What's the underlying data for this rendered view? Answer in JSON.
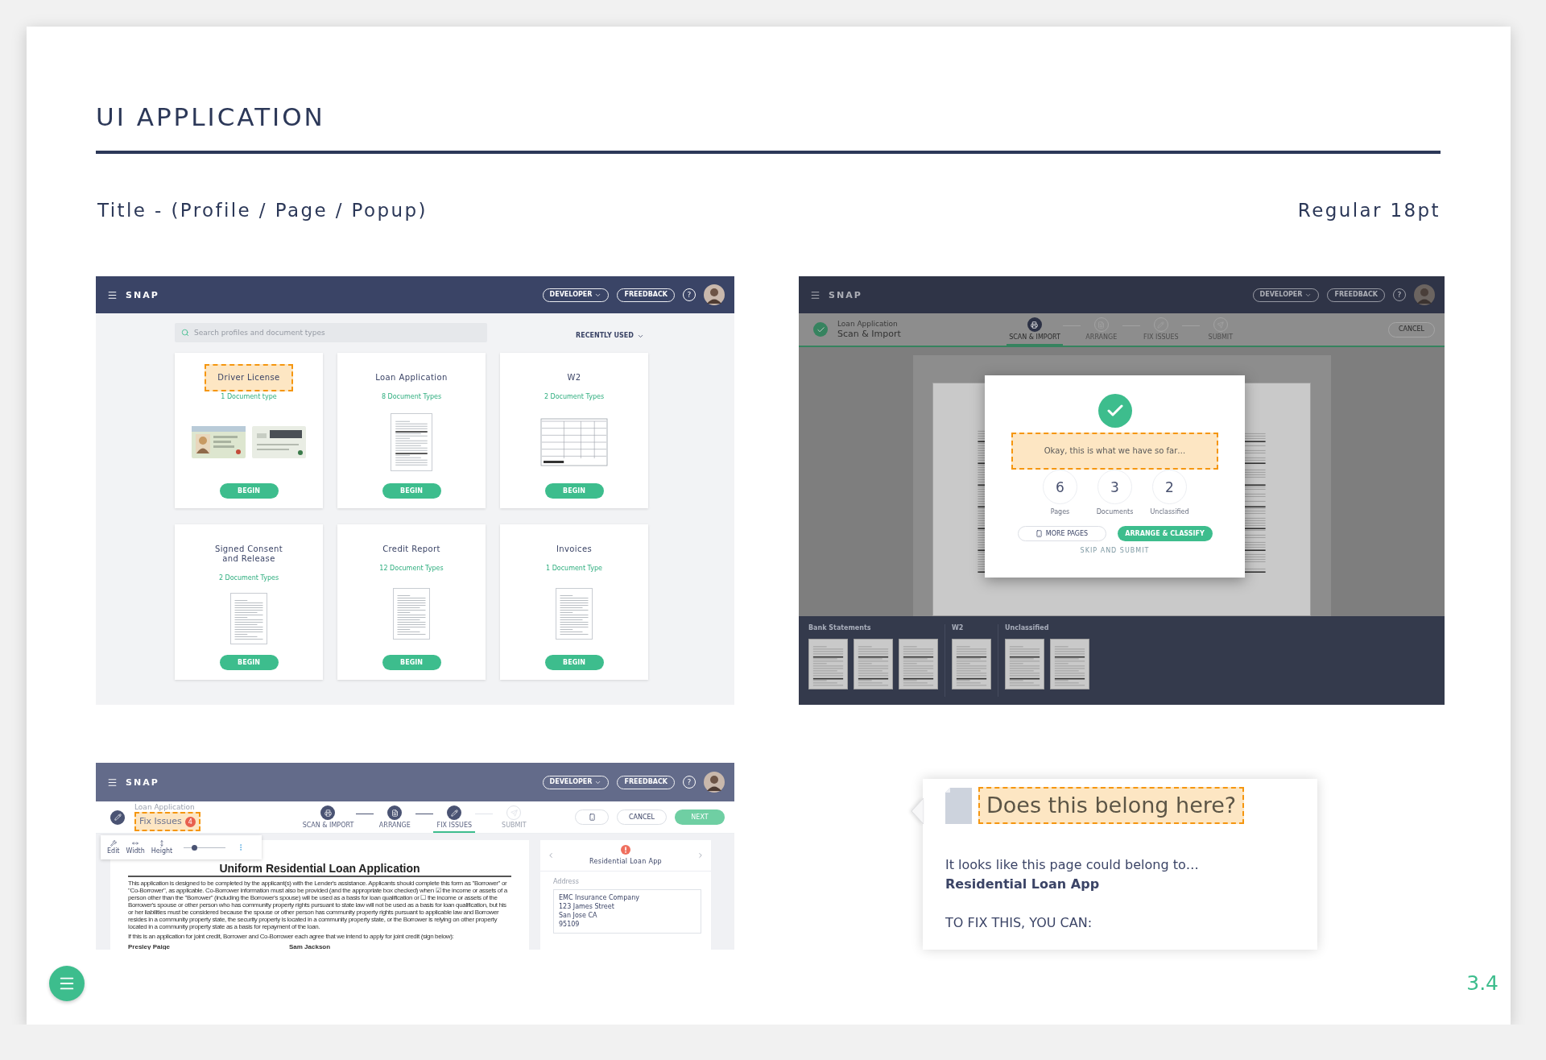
{
  "slide": {
    "title": "UI APPLICATION",
    "label": "Title - (Profile / Page / Popup)",
    "spec": "Regular 18pt",
    "page_number": "3.4"
  },
  "profile_screen": {
    "header": {
      "brand": "SNAP",
      "developer": "DEVELOPER",
      "feedback": "FREEDBACK",
      "help": "?"
    },
    "search": {
      "placeholder": "Search profiles and document types"
    },
    "sort": "RECENTLY USED",
    "cards": [
      {
        "title": "Driver License",
        "types": "1 Document type",
        "kind": "id_cards",
        "button": "BEGIN",
        "highlighted": true
      },
      {
        "title": "Loan Application",
        "types": "8 Document Types",
        "kind": "form",
        "button": "BEGIN",
        "highlighted": false
      },
      {
        "title": "W2",
        "types": "2 Document Types",
        "kind": "w2",
        "button": "BEGIN",
        "highlighted": false
      },
      {
        "title": "Signed Consent\nand Release",
        "types": "2 Document Types",
        "kind": "document",
        "button": "BEGIN",
        "highlighted": false
      },
      {
        "title": "Credit Report",
        "types": "12 Document Types",
        "kind": "document",
        "button": "BEGIN",
        "highlighted": false
      },
      {
        "title": "Invoices",
        "types": "1 Document Type",
        "kind": "document",
        "button": "BEGIN",
        "highlighted": false
      }
    ]
  },
  "page_screen": {
    "header": {
      "brand": "SNAP",
      "developer": "DEVELOPER",
      "feedback": "FREEDBACK",
      "help": "?"
    },
    "task": {
      "status": "Loan Application",
      "title": "Scan & Import"
    },
    "steps": [
      {
        "label": "SCAN & IMPORT",
        "done": true,
        "selected": true
      },
      {
        "label": "ARRANGE",
        "done": false,
        "selected": false
      },
      {
        "label": "FIX ISSUES",
        "done": false,
        "selected": false
      },
      {
        "label": "SUBMIT",
        "done": false,
        "selected": false
      }
    ],
    "cancel": "CANCEL",
    "dialog": {
      "message": "Okay, this is what we have so far…",
      "highlighted": true,
      "stats": [
        {
          "value": "6",
          "label": "Pages"
        },
        {
          "value": "3",
          "label": "Documents"
        },
        {
          "value": "2",
          "label": "Unclassified"
        }
      ],
      "secondary": "MORE PAGES",
      "primary": "ARRANGE & CLASSIFY",
      "skip": "SKIP AND SUBMIT"
    },
    "filmstrip": [
      {
        "label": "Bank Statements",
        "thumbnails": [
          {
            "kind": "page"
          },
          {
            "kind": "page"
          },
          {
            "kind": "page"
          }
        ]
      },
      {
        "label": "W2",
        "thumbnails": [
          {
            "kind": "page"
          }
        ]
      },
      {
        "label": "Unclassified",
        "thumbnails": [
          {
            "kind": "page"
          },
          {
            "kind": "page"
          }
        ]
      }
    ]
  },
  "popup_screen": {
    "header": {
      "brand": "SNAP",
      "developer": "DEVELOPER",
      "feedback": "FREEDBACK",
      "help": "?"
    },
    "task": {
      "status": "Loan Application",
      "title": "Fix Issues",
      "badge": "4",
      "highlighted": true
    },
    "steps": [
      {
        "label": "SCAN & IMPORT",
        "done": true,
        "selected": false
      },
      {
        "label": "ARRANGE",
        "done": true,
        "selected": false
      },
      {
        "label": "FIX ISSUES",
        "done": true,
        "selected": true
      },
      {
        "label": "SUBMIT",
        "done": false,
        "selected": false
      }
    ],
    "cancel": "CANCEL",
    "next": "NEXT",
    "tools": [
      {
        "label": "Edit"
      },
      {
        "label": "Width"
      },
      {
        "label": "Height"
      }
    ],
    "zoom": {
      "level": 0.25
    },
    "document": {
      "title": "Uniform Residential Loan Application",
      "paragraph": "This application is designed to be completed by the applicant(s) with the Lender's assistance. Applicants should complete this form as \"Borrower\" or \"Co-Borrower\", as applicable. Co-Borrower information must also be provided (and the appropriate box checked) when ☑ the income or assets of a person other than the \"Borrower\" (including the Borrower's spouse) will be used as a basis for loan qualification or ☐ the income or assets of the Borrower's spouse or other person who has community property rights pursuant to state law will not be used as a basis for loan qualification, but his or her liabilities must be considered because the spouse or other person has community property rights pursuant to applicable law and Borrower resides in a community property state, the security property is located in a community property state, or the Borrower is relying on other property located in a community property state as a basis for repayment of the loan.",
      "joint": "If this is an application for joint credit, Borrower and Co-Borrower each agree that we intend to apply for joint credit (sign below):",
      "signers": [
        "Presley Paige",
        "Sam Jackson"
      ]
    },
    "side_panel": {
      "title": "Residential Loan App",
      "field_label": "Address",
      "address": [
        "EMC Insurance Company",
        "123 James Street",
        "San Jose CA",
        "95109"
      ]
    }
  },
  "popover": {
    "title": "Does this belong here?",
    "highlighted": true,
    "body": "It looks like this page could belong to…",
    "suggestion": "Residential Loan App",
    "fix_heading": "TO FIX THIS, YOU CAN:"
  }
}
